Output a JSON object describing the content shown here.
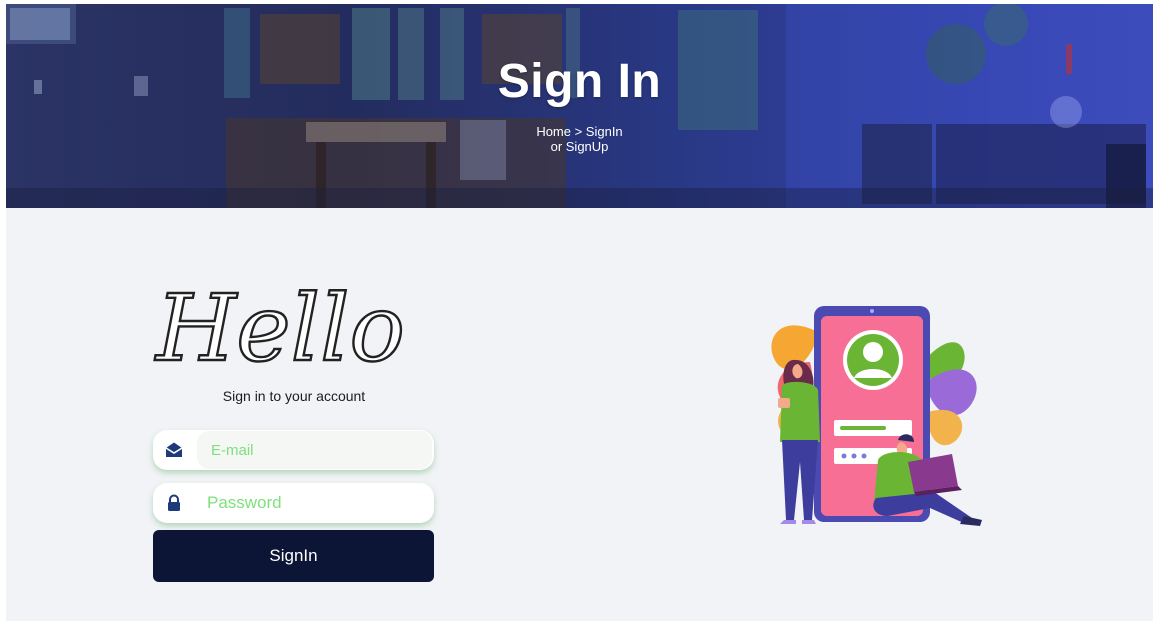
{
  "hero": {
    "title": "Sign In",
    "breadcrumb_line1": "Home > SignIn",
    "breadcrumb_line2": "or SignUp"
  },
  "form": {
    "greeting": "Hello",
    "subtitle": "Sign in to your account",
    "email": {
      "placeholder": "E-mail",
      "value": "",
      "icon": "envelope-open-icon"
    },
    "password": {
      "placeholder": "Password",
      "value": "",
      "icon": "lock-icon"
    },
    "submit_label": "SignIn"
  },
  "colors": {
    "hero_overlay": "#2c3a8f",
    "page_bg": "#f1f3f6",
    "button_bg": "#0c1536",
    "placeholder": "#7ee07e",
    "field_shadow": "#46a050",
    "icon": "#1f3a7a"
  },
  "illustration": {
    "icons": [
      "phone-icon",
      "user-avatar-icon",
      "person-standing-figure",
      "person-sitting-laptop-figure",
      "leaves-decoration"
    ]
  }
}
